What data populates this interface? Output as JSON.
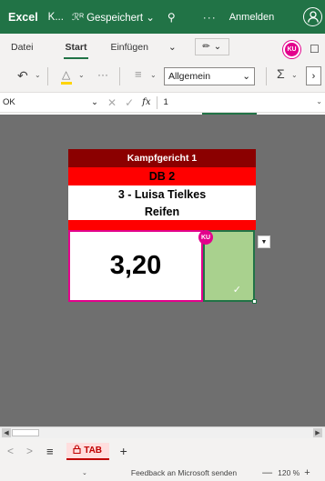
{
  "titlebar": {
    "app": "Excel",
    "doc": "K...",
    "share_glyph": "ℛᴿ",
    "status": "Gespeichert",
    "more": "···",
    "signin": "Anmelden"
  },
  "ribbon": {
    "tabs": [
      "Datei",
      "Start",
      "Einfügen"
    ],
    "active_tab": "Start",
    "number_format": "Allgemein",
    "collab_initials": "KU"
  },
  "formula_bar": {
    "name_box": "OK",
    "fx": "fx",
    "value": "1"
  },
  "board": {
    "title": "Kampfgericht 1",
    "apparatus_code": "DB 2",
    "athlete": "3 - Luisa Tielkes",
    "apparatus": "Reifen",
    "score": "3,20",
    "cell_user": "KU"
  },
  "sheet": {
    "tab_name": "TAB"
  },
  "status": {
    "feedback": "Feedback an Microsoft senden",
    "zoom": "120 %"
  },
  "colors": {
    "excel_green": "#217346",
    "title_row": "#8b0000",
    "red_row": "#ff0000",
    "collab_pink": "#e3008c",
    "green_cell": "#a9d18e"
  }
}
